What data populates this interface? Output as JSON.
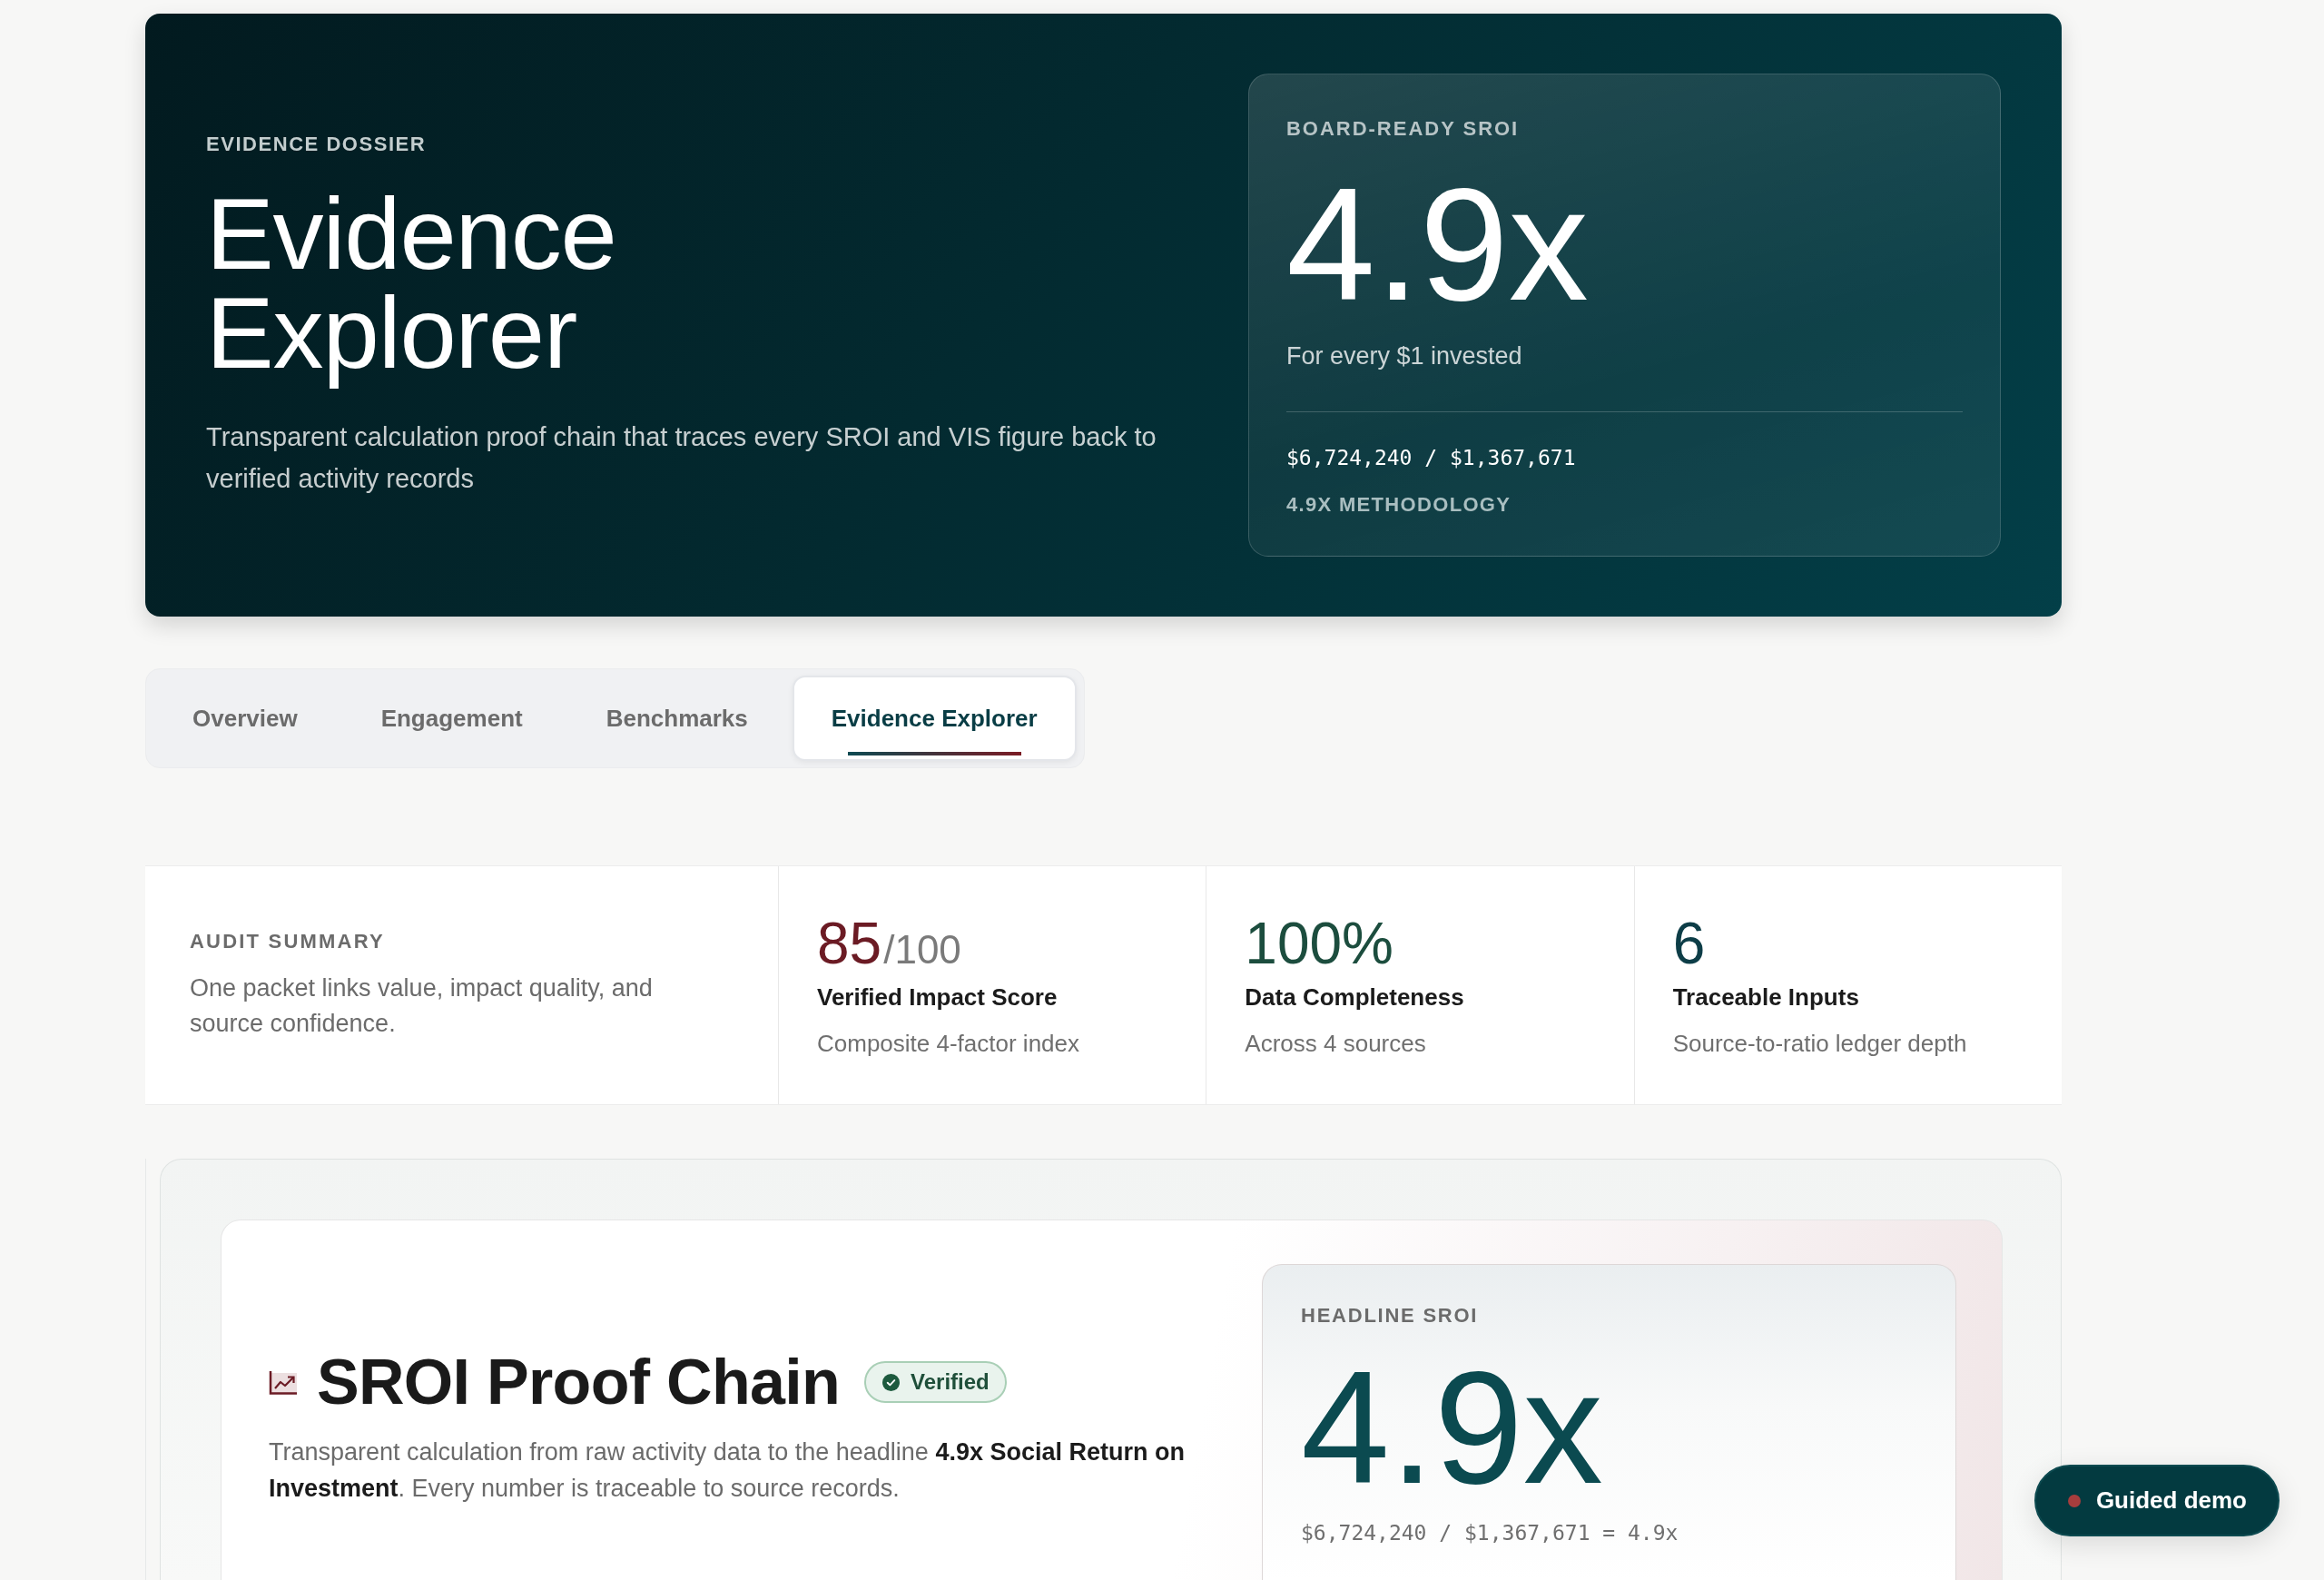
{
  "hero": {
    "eyebrow": "EVIDENCE DOSSIER",
    "title": "Evidence Explorer",
    "description": "Transparent calculation proof chain that traces every SROI and VIS figure back to verified activity records",
    "sroi_card": {
      "label": "BOARD-READY SROI",
      "value": "4.9x",
      "caption": "For every $1 invested",
      "formula": "$6,724,240 / $1,367,671",
      "link": "4.9X METHODOLOGY"
    }
  },
  "tabs": [
    {
      "label": "Overview",
      "selected": false
    },
    {
      "label": "Engagement",
      "selected": false
    },
    {
      "label": "Benchmarks",
      "selected": false
    },
    {
      "label": "Evidence Explorer",
      "selected": true
    }
  ],
  "audit_summary": {
    "label": "AUDIT SUMMARY",
    "description": "One packet links value, impact quality, and source confidence.",
    "metrics": [
      {
        "value": "85",
        "suffix": "/100",
        "title": "Verified Impact Score",
        "caption": "Composite 4-factor index",
        "color": "#6b1b24"
      },
      {
        "value": "100%",
        "title": "Data Completeness",
        "caption": "Across 4 sources",
        "color": "#1c4d3e"
      },
      {
        "value": "6",
        "title": "Traceable Inputs",
        "caption": "Source-to-ratio ledger depth",
        "color": "#0d3d47"
      }
    ]
  },
  "proof_chain": {
    "title": "SROI Proof Chain",
    "badge": "Verified",
    "description": "Transparent calculation from raw activity data to the headline **4.9x Social Return on Investment**. Every number is traceable to source records.",
    "headline_sroi": {
      "label": "HEADLINE SROI",
      "value": "4.9x",
      "formula": "$6,724,240 / $1,367,671 = 4.9x"
    }
  },
  "guided_demo": {
    "label": "Guided demo"
  }
}
